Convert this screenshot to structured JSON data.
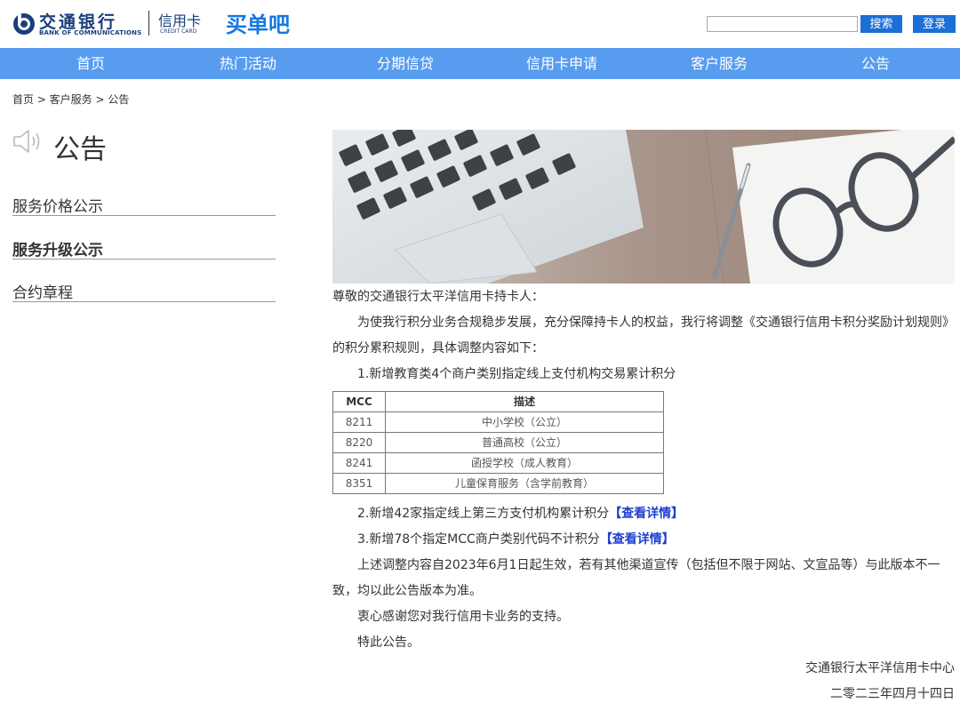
{
  "header": {
    "brand_cn": "交通银行",
    "brand_en": "BANK OF COMMUNICATIONS",
    "credit_card_cn": "信用卡",
    "credit_card_en": "CREDIT CARD",
    "site_name": "买单吧",
    "search_placeholder": "",
    "search_label": "搜索",
    "login_label": "登录"
  },
  "nav": [
    "首页",
    "热门活动",
    "分期信贷",
    "信用卡申请",
    "客户服务",
    "公告"
  ],
  "breadcrumb": "首页 > 客户服务 > 公告",
  "page_title": "公告",
  "sidebar": [
    {
      "label": "服务价格公示"
    },
    {
      "label": "服务升级公示"
    },
    {
      "label": "合约章程"
    }
  ],
  "article": {
    "greeting": "尊敬的交通银行太平洋信用卡持卡人：",
    "intro": "为使我行积分业务合规稳步发展，充分保障持卡人的权益，我行将调整《交通银行信用卡积分奖励计划规则》的积分累积规则，具体调整内容如下：",
    "item1": "1.新增教育类4个商户类别指定线上支付机构交易累计积分",
    "table": {
      "headers": [
        "MCC",
        "描述"
      ],
      "rows": [
        [
          "8211",
          "中小学校（公立）"
        ],
        [
          "8220",
          "普通高校（公立）"
        ],
        [
          "8241",
          "函授学校（成人教育）"
        ],
        [
          "8351",
          "儿童保育服务（含学前教育）"
        ]
      ]
    },
    "item2": "2.新增42家指定线上第三方支付机构累计积分",
    "item3": "3.新增78个指定MCC商户类别代码不计积分",
    "detail_link": "【查看详情】",
    "effective": "上述调整内容自2023年6月1日起生效，若有其他渠道宣传（包括但不限于网站、文宣品等）与此版本不一致，均以此公告版本为准。",
    "thanks": "衷心感谢您对我行信用卡业务的支持。",
    "closing": "特此公告。",
    "signature": "交通银行太平洋信用卡中心",
    "date": "二零二三年四月十四日"
  }
}
